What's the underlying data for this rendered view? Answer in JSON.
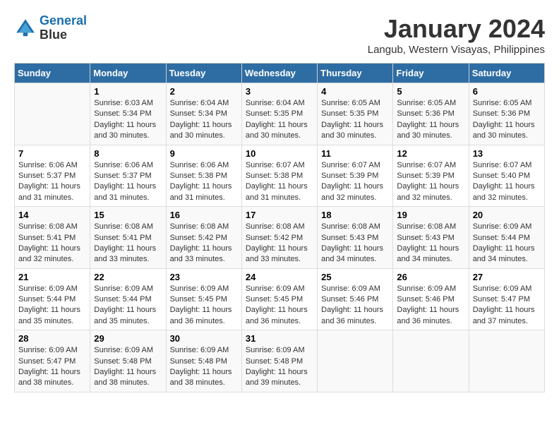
{
  "header": {
    "logo_line1": "General",
    "logo_line2": "Blue",
    "month": "January 2024",
    "location": "Langub, Western Visayas, Philippines"
  },
  "days_of_week": [
    "Sunday",
    "Monday",
    "Tuesday",
    "Wednesday",
    "Thursday",
    "Friday",
    "Saturday"
  ],
  "weeks": [
    [
      {
        "day": "",
        "info": ""
      },
      {
        "day": "1",
        "info": "Sunrise: 6:03 AM\nSunset: 5:34 PM\nDaylight: 11 hours\nand 30 minutes."
      },
      {
        "day": "2",
        "info": "Sunrise: 6:04 AM\nSunset: 5:34 PM\nDaylight: 11 hours\nand 30 minutes."
      },
      {
        "day": "3",
        "info": "Sunrise: 6:04 AM\nSunset: 5:35 PM\nDaylight: 11 hours\nand 30 minutes."
      },
      {
        "day": "4",
        "info": "Sunrise: 6:05 AM\nSunset: 5:35 PM\nDaylight: 11 hours\nand 30 minutes."
      },
      {
        "day": "5",
        "info": "Sunrise: 6:05 AM\nSunset: 5:36 PM\nDaylight: 11 hours\nand 30 minutes."
      },
      {
        "day": "6",
        "info": "Sunrise: 6:05 AM\nSunset: 5:36 PM\nDaylight: 11 hours\nand 30 minutes."
      }
    ],
    [
      {
        "day": "7",
        "info": "Sunrise: 6:06 AM\nSunset: 5:37 PM\nDaylight: 11 hours\nand 31 minutes."
      },
      {
        "day": "8",
        "info": "Sunrise: 6:06 AM\nSunset: 5:37 PM\nDaylight: 11 hours\nand 31 minutes."
      },
      {
        "day": "9",
        "info": "Sunrise: 6:06 AM\nSunset: 5:38 PM\nDaylight: 11 hours\nand 31 minutes."
      },
      {
        "day": "10",
        "info": "Sunrise: 6:07 AM\nSunset: 5:38 PM\nDaylight: 11 hours\nand 31 minutes."
      },
      {
        "day": "11",
        "info": "Sunrise: 6:07 AM\nSunset: 5:39 PM\nDaylight: 11 hours\nand 32 minutes."
      },
      {
        "day": "12",
        "info": "Sunrise: 6:07 AM\nSunset: 5:39 PM\nDaylight: 11 hours\nand 32 minutes."
      },
      {
        "day": "13",
        "info": "Sunrise: 6:07 AM\nSunset: 5:40 PM\nDaylight: 11 hours\nand 32 minutes."
      }
    ],
    [
      {
        "day": "14",
        "info": "Sunrise: 6:08 AM\nSunset: 5:41 PM\nDaylight: 11 hours\nand 32 minutes."
      },
      {
        "day": "15",
        "info": "Sunrise: 6:08 AM\nSunset: 5:41 PM\nDaylight: 11 hours\nand 33 minutes."
      },
      {
        "day": "16",
        "info": "Sunrise: 6:08 AM\nSunset: 5:42 PM\nDaylight: 11 hours\nand 33 minutes."
      },
      {
        "day": "17",
        "info": "Sunrise: 6:08 AM\nSunset: 5:42 PM\nDaylight: 11 hours\nand 33 minutes."
      },
      {
        "day": "18",
        "info": "Sunrise: 6:08 AM\nSunset: 5:43 PM\nDaylight: 11 hours\nand 34 minutes."
      },
      {
        "day": "19",
        "info": "Sunrise: 6:08 AM\nSunset: 5:43 PM\nDaylight: 11 hours\nand 34 minutes."
      },
      {
        "day": "20",
        "info": "Sunrise: 6:09 AM\nSunset: 5:44 PM\nDaylight: 11 hours\nand 34 minutes."
      }
    ],
    [
      {
        "day": "21",
        "info": "Sunrise: 6:09 AM\nSunset: 5:44 PM\nDaylight: 11 hours\nand 35 minutes."
      },
      {
        "day": "22",
        "info": "Sunrise: 6:09 AM\nSunset: 5:44 PM\nDaylight: 11 hours\nand 35 minutes."
      },
      {
        "day": "23",
        "info": "Sunrise: 6:09 AM\nSunset: 5:45 PM\nDaylight: 11 hours\nand 36 minutes."
      },
      {
        "day": "24",
        "info": "Sunrise: 6:09 AM\nSunset: 5:45 PM\nDaylight: 11 hours\nand 36 minutes."
      },
      {
        "day": "25",
        "info": "Sunrise: 6:09 AM\nSunset: 5:46 PM\nDaylight: 11 hours\nand 36 minutes."
      },
      {
        "day": "26",
        "info": "Sunrise: 6:09 AM\nSunset: 5:46 PM\nDaylight: 11 hours\nand 36 minutes."
      },
      {
        "day": "27",
        "info": "Sunrise: 6:09 AM\nSunset: 5:47 PM\nDaylight: 11 hours\nand 37 minutes."
      }
    ],
    [
      {
        "day": "28",
        "info": "Sunrise: 6:09 AM\nSunset: 5:47 PM\nDaylight: 11 hours\nand 38 minutes."
      },
      {
        "day": "29",
        "info": "Sunrise: 6:09 AM\nSunset: 5:48 PM\nDaylight: 11 hours\nand 38 minutes."
      },
      {
        "day": "30",
        "info": "Sunrise: 6:09 AM\nSunset: 5:48 PM\nDaylight: 11 hours\nand 38 minutes."
      },
      {
        "day": "31",
        "info": "Sunrise: 6:09 AM\nSunset: 5:48 PM\nDaylight: 11 hours\nand 39 minutes."
      },
      {
        "day": "",
        "info": ""
      },
      {
        "day": "",
        "info": ""
      },
      {
        "day": "",
        "info": ""
      }
    ]
  ]
}
